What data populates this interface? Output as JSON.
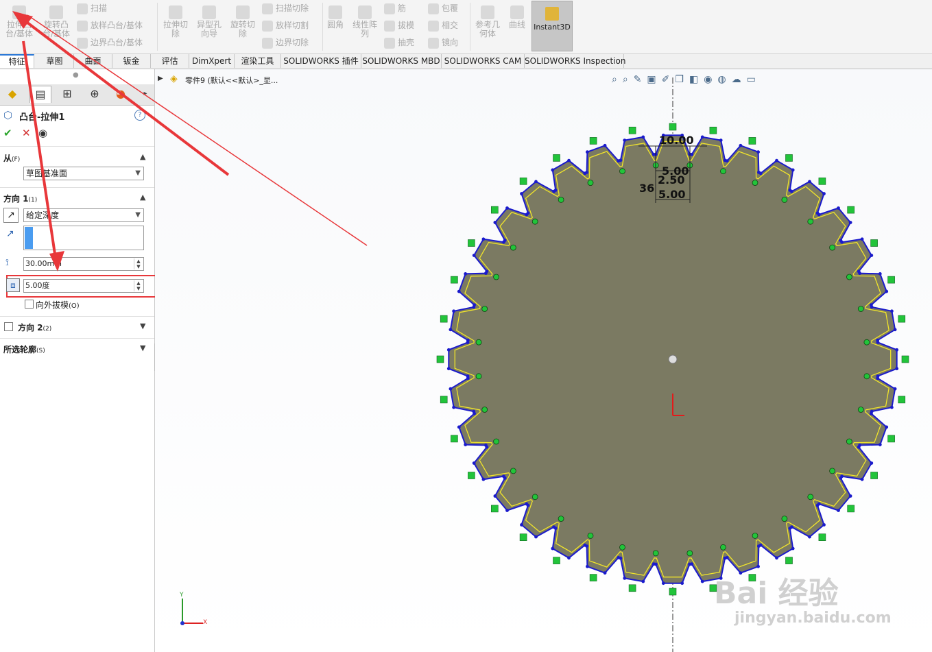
{
  "ribbon": {
    "extrude_boss": "拉伸凸台/基体",
    "revolve_boss": "旋转凸台/基体",
    "sweep": "扫描",
    "loft_boss": "放样凸台/基体",
    "boundary_boss": "边界凸台/基体",
    "extrude_cut": "拉伸切除",
    "hole_wizard": "异型孔向导",
    "revolve_cut": "旋转切除",
    "swept_cut": "扫描切除",
    "lofted_cut": "放样切割",
    "boundary_cut": "边界切除",
    "fillet": "圆角",
    "linear_pattern": "线性阵列",
    "rib": "筋",
    "draft": "拔模",
    "shell": "抽壳",
    "wrap": "包覆",
    "intersect": "相交",
    "mirror": "镜向",
    "ref_geometry": "参考几何体",
    "curves": "曲线",
    "instant3d": "Instant3D"
  },
  "tabs": [
    "特征",
    "草图",
    "曲面",
    "钣金",
    "评估",
    "DimXpert",
    "渲染工具",
    "SOLIDWORKS 插件",
    "SOLIDWORKS MBD",
    "SOLIDWORKS CAM",
    "SOLIDWORKS Inspection"
  ],
  "panel": {
    "title": "凸台-拉伸1",
    "help": "?",
    "ok": "✔",
    "cancel": "✕",
    "from_label": "从",
    "from_key": "(F)",
    "from_value": "草图基准面",
    "dir1_label": "方向 1",
    "dir1_key": "(1)",
    "end_condition": "给定深度",
    "depth": "30.00mm",
    "draft_angle": "5.00度",
    "draft_outward": "向外拔模",
    "draft_outward_key": "(O)",
    "dir2_label": "方向 2",
    "dir2_key": "(2)",
    "selected_contours": "所选轮廓",
    "selected_contours_key": "(S)"
  },
  "viewport": {
    "breadcrumb": "零件9 (默认<<默认>_显...",
    "dims": {
      "d1": "10.00",
      "d2": "5.00",
      "d3": "2.50",
      "d4": "5.00",
      "d5": "36"
    },
    "axis_y": "Y",
    "axis_x": "X",
    "watermark_main": "Bai  经验",
    "watermark_sub": "jingyan.baidu.com"
  },
  "gear": {
    "teeth": 36,
    "fill_color": "#7b7a62",
    "outline_color": "#1a1acc",
    "inner_color": "#f2e62a"
  },
  "colors": {
    "arrow": "#e8373a",
    "highlight_box": "#e8373a",
    "accent": "#2b78d6"
  }
}
